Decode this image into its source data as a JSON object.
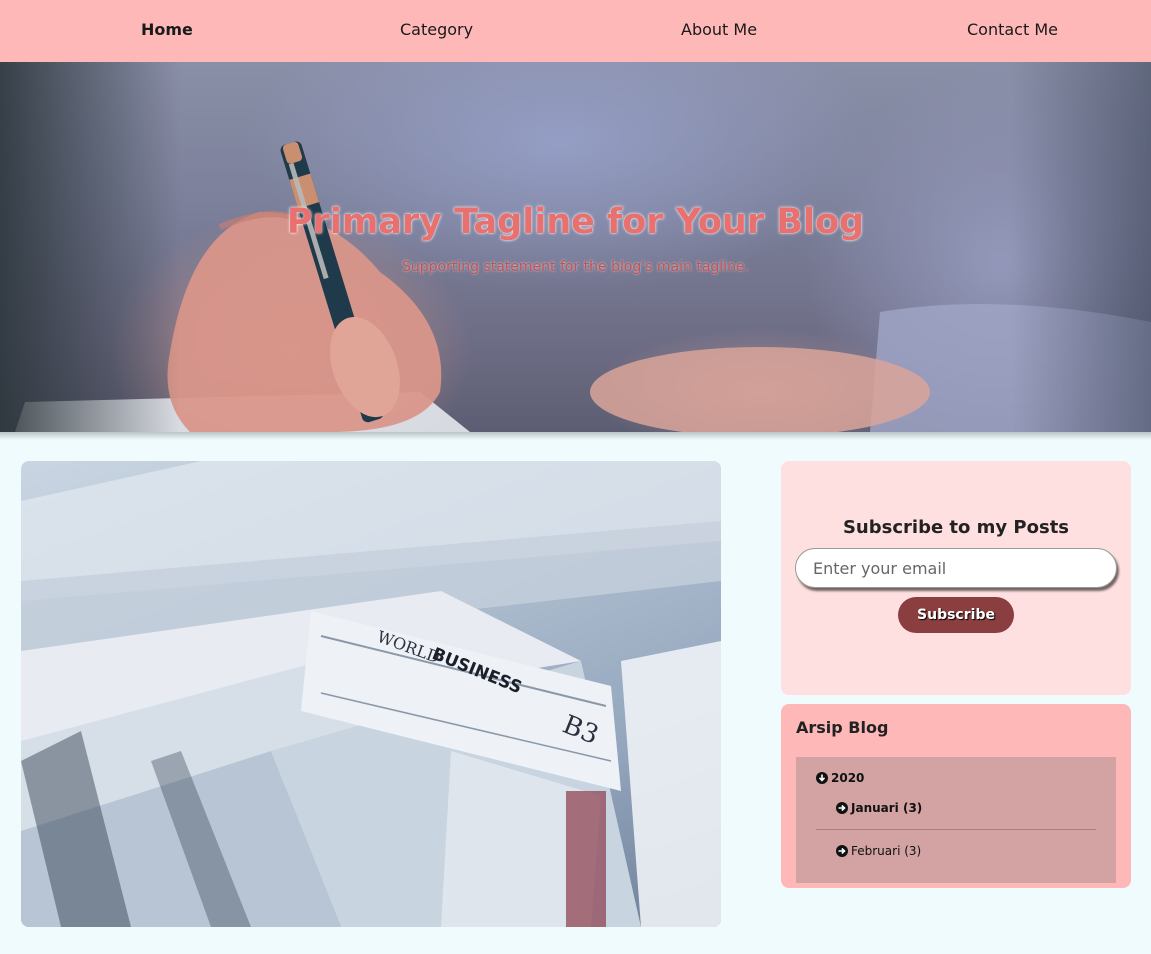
{
  "nav": {
    "items": [
      {
        "label": "Home",
        "active": true
      },
      {
        "label": "Category",
        "active": false
      },
      {
        "label": "About Me",
        "active": false
      },
      {
        "label": "Contact Me",
        "active": false
      }
    ]
  },
  "hero": {
    "title": "Primary Tagline for Your Blog",
    "subtitle": "Supporting statement for the blog's main tagline."
  },
  "featured": {
    "image_icon": "newspaper-image"
  },
  "subscribe": {
    "title": "Subscribe to my Posts",
    "email_placeholder": "Enter your email",
    "email_value": "",
    "button_label": "Subscribe"
  },
  "archive": {
    "title": "Arsip Blog",
    "year": "2020",
    "months": [
      {
        "label": "Januari",
        "count": "(3)",
        "bold": true
      },
      {
        "label": "Februari",
        "count": "(3)",
        "bold": false
      }
    ]
  },
  "colors": {
    "nav_bg": "#ffb8b8",
    "page_bg": "#f0fbfd",
    "subscribe_card_bg": "#ffe0e0",
    "subscribe_button": "#8b3e3f",
    "archive_card_bg": "#ffb8b8",
    "archive_box_bg": "#d3a2a2",
    "hero_title": "#e8706e"
  }
}
